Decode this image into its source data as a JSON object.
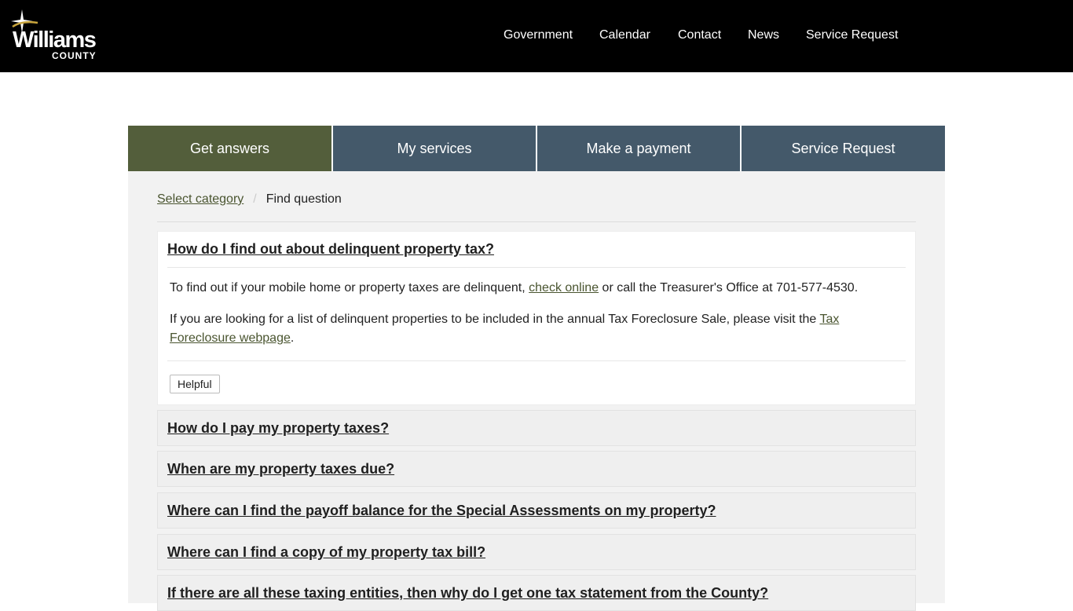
{
  "header": {
    "logo": {
      "name": "Williams",
      "sub": "COUNTY"
    },
    "nav": [
      "Government",
      "Calendar",
      "Contact",
      "News",
      "Service Request"
    ]
  },
  "tabs": [
    {
      "label": "Get answers",
      "active": true
    },
    {
      "label": "My services",
      "active": false
    },
    {
      "label": "Make a payment",
      "active": false
    },
    {
      "label": "Service Request",
      "active": false
    }
  ],
  "breadcrumb": {
    "link": "Select category",
    "current": "Find question"
  },
  "open_faq": {
    "question": "How do I find out about delinquent property tax?",
    "p1_before": "To find out if your mobile home or property taxes are delinquent, ",
    "p1_link": "check online",
    "p1_after": " or call the Treasurer's Office at 701-577-4530.",
    "p2_before": "If you are looking for a list of delinquent properties to be included in the annual Tax Foreclosure Sale, please visit the ",
    "p2_link": "Tax Foreclosure webpage",
    "p2_after": ".",
    "helpful_label": "Helpful"
  },
  "faqs": [
    "How do I pay my property taxes?",
    "When are my property taxes due?",
    "Where can I find the payoff balance for the Special Assessments on my property?",
    "Where can I find a copy of my property tax bill?",
    "If there are all these taxing entities, then why do I get one tax statement from the County?"
  ],
  "colors": {
    "header_bg": "#000000",
    "tab_active": "#535e3b",
    "tab_inactive": "#44596a",
    "link": "#4a5530",
    "logo_accent": "#c8a43c"
  }
}
